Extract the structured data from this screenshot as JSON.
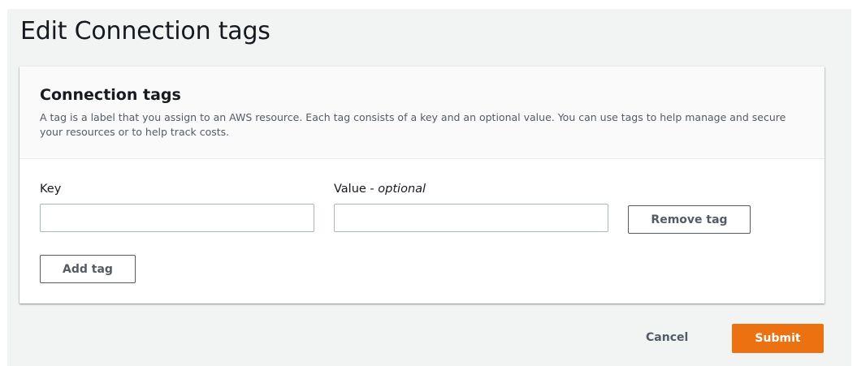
{
  "page": {
    "title": "Edit Connection tags"
  },
  "panel": {
    "title": "Connection tags",
    "description": "A tag is a label that you assign to an AWS resource. Each tag consists of a key and an optional value. You can use tags to help manage and secure your resources or to help track costs."
  },
  "tags": {
    "key_label": "Key",
    "value_label": "Value - ",
    "value_label_optional": "optional",
    "key_value": "",
    "value_value": "",
    "remove_label": "Remove tag",
    "add_label": "Add tag"
  },
  "footer": {
    "cancel_label": "Cancel",
    "submit_label": "Submit"
  },
  "colors": {
    "primary": "#ec7211",
    "page_background": "#f2f3f3",
    "border": "#aab7b8"
  }
}
